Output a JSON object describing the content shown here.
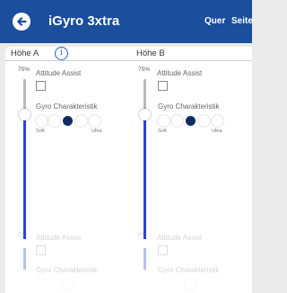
{
  "appbar": {
    "title": "iGyro 3xtra",
    "actions": [
      "Quer",
      "Seite"
    ],
    "back_icon": "arrow-left-circle-icon",
    "color": "#1b4e9c"
  },
  "columns": [
    {
      "header": "Höhe A",
      "info_icon": "info-icon",
      "top": {
        "percent": "75%",
        "slider_level": 0.75,
        "attitude_label": "Attitude Assist",
        "attitude_checked": false,
        "gyro_label": "Gyro Charakteristik",
        "gyro_levels": 5,
        "gyro_selected_index": 2,
        "soft_label": "Soft",
        "ultra_label": "Ultra"
      },
      "bottom": {
        "percent": "0%",
        "attitude_label": "Attitude Assist",
        "gyro_label": "Gyro Charakteristik"
      }
    },
    {
      "header": "Höhe B",
      "top": {
        "percent": "75%",
        "slider_level": 0.75,
        "attitude_label": "Attitude Assist",
        "attitude_checked": false,
        "gyro_label": "Gyro Charakteristik",
        "gyro_levels": 5,
        "gyro_selected_index": 2,
        "soft_label": "Soft",
        "ultra_label": "Ultra"
      },
      "bottom": {
        "percent": "0%",
        "attitude_label": "Attitude Assist",
        "gyro_label": "Gyro Charakteristik"
      }
    }
  ],
  "colors": {
    "slider_fill": "#2a43d9",
    "selected_dot": "#0d2d63"
  }
}
